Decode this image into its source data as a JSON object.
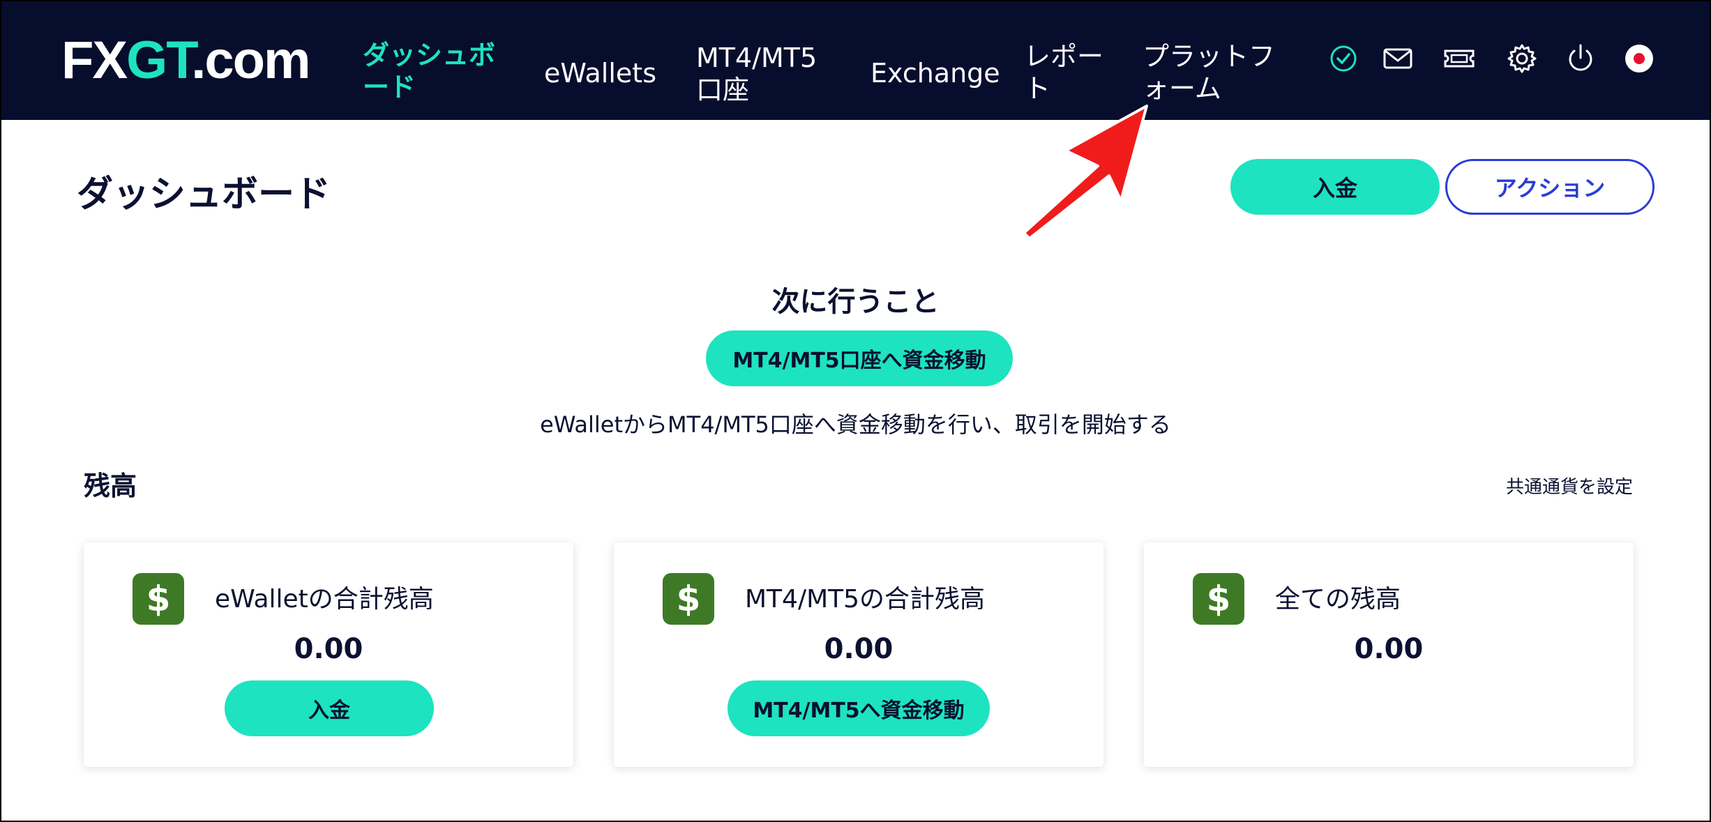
{
  "header": {
    "logo_prefix": "FX",
    "logo_accent": "GT",
    "logo_suffix": ".com",
    "nav": {
      "dashboard": "ダッシュボード",
      "ewallets": "eWallets",
      "accounts": "MT4/MT5口座",
      "exchange": "Exchange",
      "reports": "レポート",
      "platforms": "プラットフォーム"
    },
    "icons": [
      "check-circle-icon",
      "mail-icon",
      "ticket-icon",
      "gear-icon",
      "power-icon",
      "flag-icon"
    ]
  },
  "page": {
    "title": "ダッシュボード",
    "deposit_button": "入金",
    "action_button": "アクション"
  },
  "next_steps": {
    "title": "次に行うこと",
    "button": "MT4/MT5口座へ資金移動",
    "description": "eWalletからMT4/MT5口座へ資金移動を行い、取引を開始する"
  },
  "balance": {
    "title": "残高",
    "currency_link": "共通通貨を設定",
    "cards": [
      {
        "icon": "$",
        "label": "eWalletの合計残高",
        "value": "0.00",
        "button": "入金"
      },
      {
        "icon": "$",
        "label": "MT4/MT5の合計残高",
        "value": "0.00",
        "button": "MT4/MT5へ資金移動"
      },
      {
        "icon": "$",
        "label": "全ての残高",
        "value": "0.00"
      }
    ]
  },
  "colors": {
    "header_bg": "#070d2d",
    "accent": "#1de3c0",
    "outline_blue": "#2a3cd6",
    "dollar_green": "#3e7a25",
    "annotation_red": "#f01c1c"
  }
}
